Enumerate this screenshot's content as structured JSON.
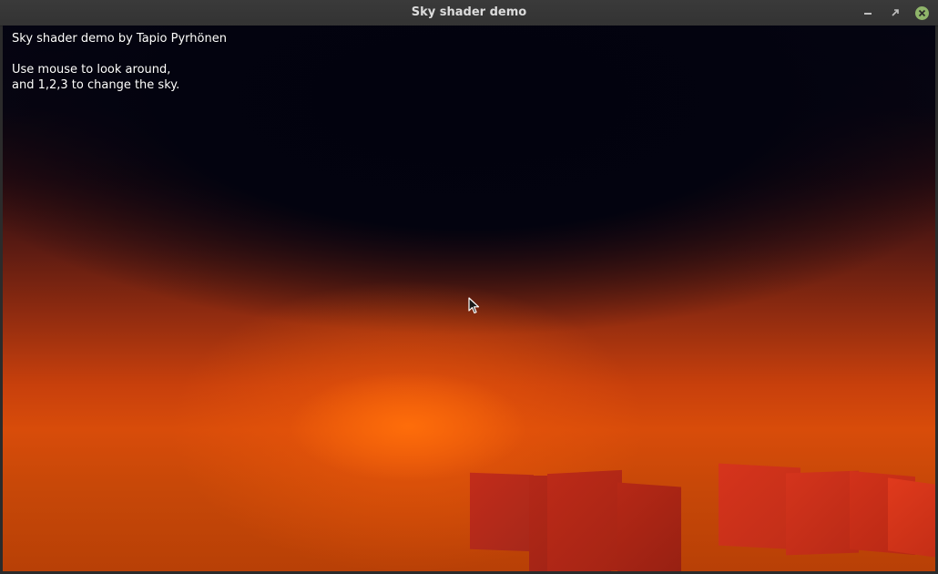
{
  "window": {
    "title": "Sky shader demo",
    "controls": {
      "minimize_icon": "minimize-icon",
      "maximize_icon": "maximize-icon",
      "close_icon": "close-icon",
      "close_color": "#8fb56a"
    }
  },
  "overlay": {
    "line1": "Sky shader demo by Tapio Pyrhönen",
    "line2": "Use mouse to look around,",
    "line3": "and 1,2,3 to change the sky."
  },
  "scene": {
    "sky_top_color": "#03030f",
    "horizon_color": "#d84c0a",
    "sun_color": "#ff6e0a",
    "block_color": "#c02a18"
  }
}
